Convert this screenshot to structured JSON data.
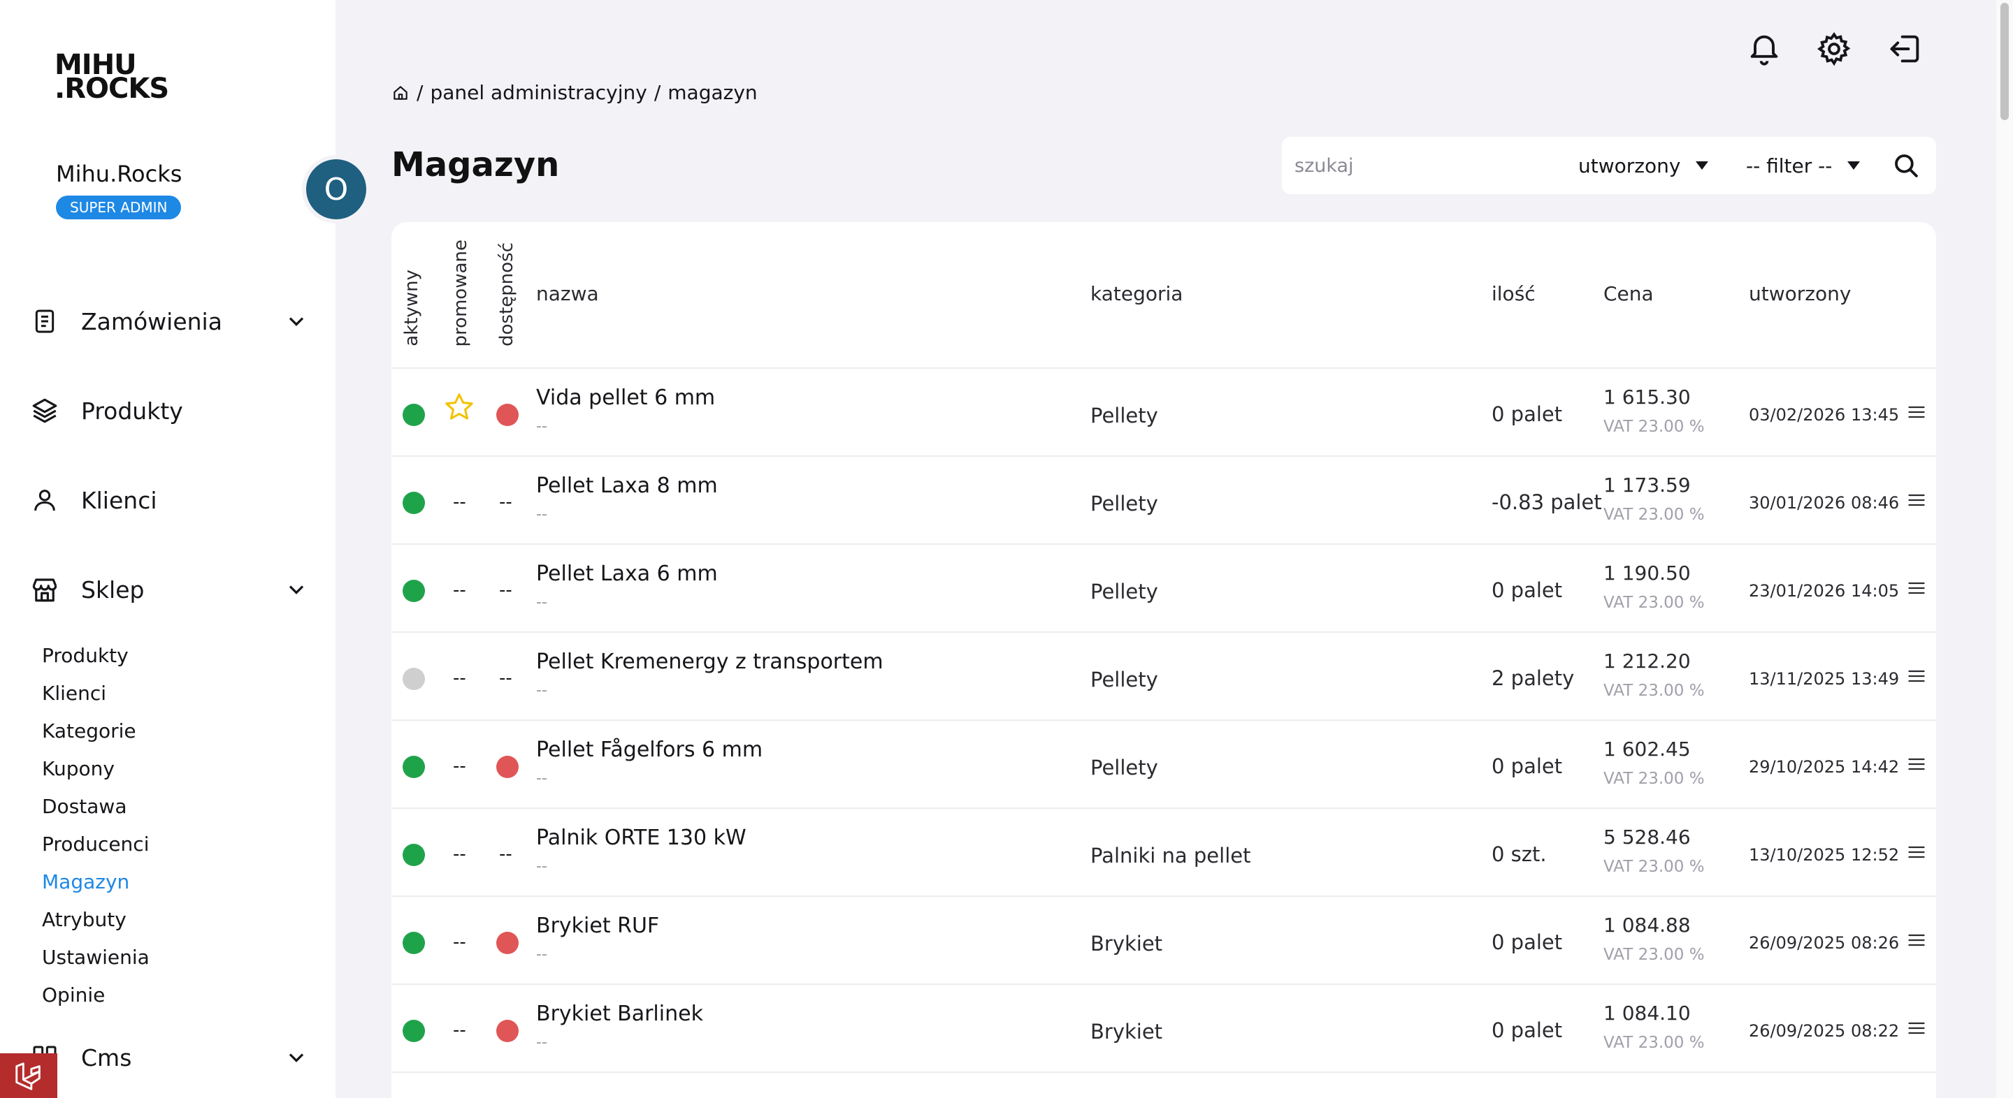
{
  "logo": {
    "line1": "MIHU",
    "line2": ".ROCKS"
  },
  "profile": {
    "name": "Mihu.Rocks",
    "role": "SUPER ADMIN",
    "avatar_initial": "O"
  },
  "nav": {
    "orders": "Zamówienia",
    "products": "Produkty",
    "clients": "Klienci",
    "shop": "Sklep",
    "cms": "Cms",
    "shop_items": [
      "Produkty",
      "Klienci",
      "Kategorie",
      "Kupony",
      "Dostawa",
      "Producenci",
      "Magazyn",
      "Atrybuty",
      "Ustawienia",
      "Opinie"
    ],
    "active_shop_item": "Magazyn"
  },
  "breadcrumb": {
    "sep": "/",
    "level1": "panel administracyjny",
    "level2": "magazyn"
  },
  "page_title": "Magazyn",
  "search": {
    "placeholder": "szukaj",
    "sort_value": "utworzony",
    "filter_value": "-- filter --"
  },
  "table": {
    "headers": {
      "active": "aktywny",
      "promoted": "promowane",
      "availability": "dostępność",
      "name": "nazwa",
      "category": "kategoria",
      "quantity": "ilość",
      "price": "Cena",
      "created": "utworzony"
    },
    "rows": [
      {
        "active": "green",
        "promoted": "star",
        "availability": "red",
        "name": "Vida pellet 6 mm",
        "sub": "--",
        "category": "Pellety",
        "quantity": "0 palet",
        "price": "1 615.30",
        "vat": "VAT 23.00 %",
        "created": "03/02/2026 13:45"
      },
      {
        "active": "green",
        "promoted": "--",
        "availability": "--",
        "name": "Pellet Laxa 8 mm",
        "sub": "--",
        "category": "Pellety",
        "quantity": "-0.83 palet",
        "price": "1 173.59",
        "vat": "VAT 23.00 %",
        "created": "30/01/2026 08:46"
      },
      {
        "active": "green",
        "promoted": "--",
        "availability": "--",
        "name": "Pellet Laxa 6 mm",
        "sub": "--",
        "category": "Pellety",
        "quantity": "0 palet",
        "price": "1 190.50",
        "vat": "VAT 23.00 %",
        "created": "23/01/2026 14:05"
      },
      {
        "active": "grey",
        "promoted": "--",
        "availability": "--",
        "name": "Pellet Kremenergy z transportem",
        "sub": "--",
        "category": "Pellety",
        "quantity": "2 palety",
        "price": "1 212.20",
        "vat": "VAT 23.00 %",
        "created": "13/11/2025 13:49"
      },
      {
        "active": "green",
        "promoted": "--",
        "availability": "red",
        "name": "Pellet Fågelfors 6 mm",
        "sub": "--",
        "category": "Pellety",
        "quantity": "0 palet",
        "price": "1 602.45",
        "vat": "VAT 23.00 %",
        "created": "29/10/2025 14:42"
      },
      {
        "active": "green",
        "promoted": "--",
        "availability": "--",
        "name": "Palnik ORTE 130 kW",
        "sub": "--",
        "category": "Palniki na pellet",
        "quantity": "0 szt.",
        "price": "5 528.46",
        "vat": "VAT 23.00 %",
        "created": "13/10/2025 12:52"
      },
      {
        "active": "green",
        "promoted": "--",
        "availability": "red",
        "name": "Brykiet RUF",
        "sub": "--",
        "category": "Brykiet",
        "quantity": "0 palet",
        "price": "1 084.88",
        "vat": "VAT 23.00 %",
        "created": "26/09/2025 08:26"
      },
      {
        "active": "green",
        "promoted": "--",
        "availability": "red",
        "name": "Brykiet Barlinek",
        "sub": "--",
        "category": "Brykiet",
        "quantity": "0 palet",
        "price": "1 084.10",
        "vat": "VAT 23.00 %",
        "created": "26/09/2025 08:22"
      }
    ]
  },
  "colors": {
    "accent": "#1e88e5",
    "green": "#1fa34a",
    "red": "#e05555",
    "grey": "#cfcfcf",
    "star": "#f2c200"
  }
}
